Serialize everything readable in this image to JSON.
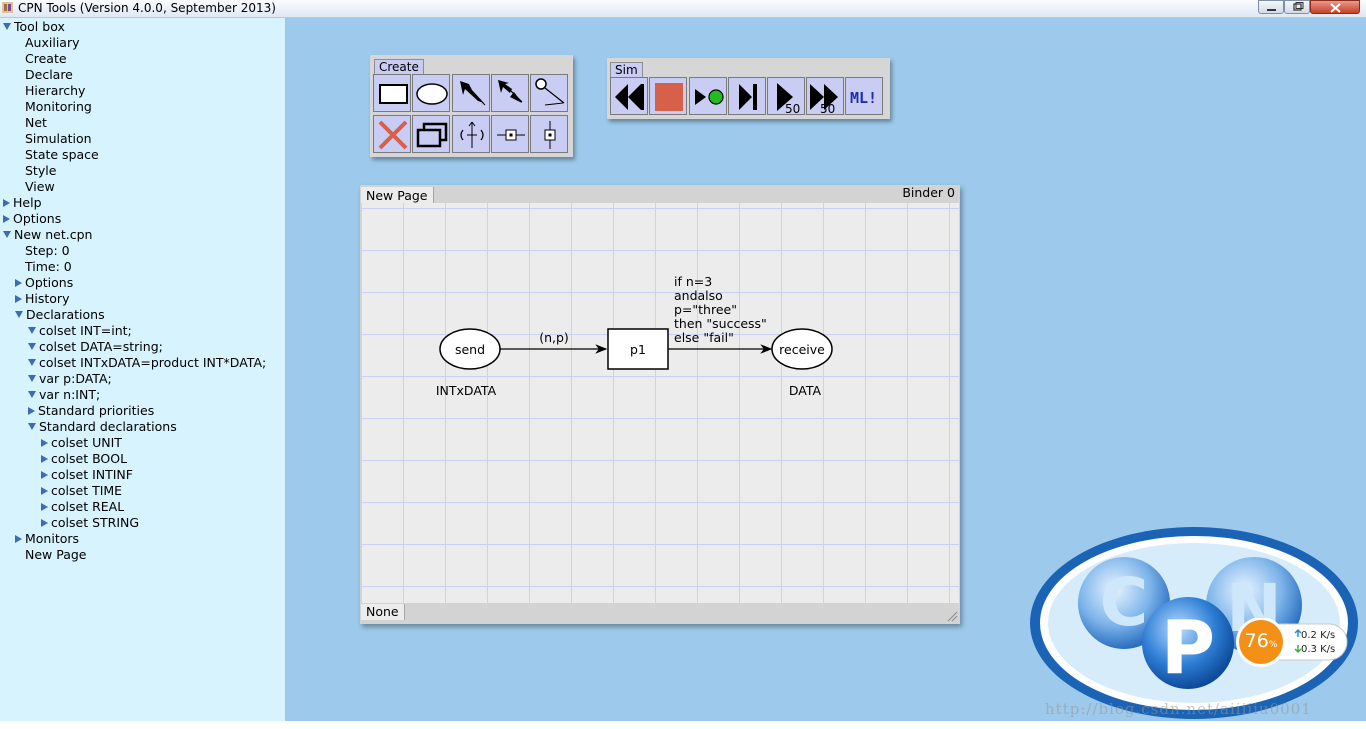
{
  "window": {
    "title": "CPN Tools (Version 4.0.0, September 2013)"
  },
  "sidebar": {
    "items": [
      {
        "label": "Tool box",
        "indent": 0,
        "expander": "down"
      },
      {
        "label": "Auxiliary",
        "indent": 1,
        "expander": "none"
      },
      {
        "label": "Create",
        "indent": 1,
        "expander": "none"
      },
      {
        "label": "Declare",
        "indent": 1,
        "expander": "none"
      },
      {
        "label": "Hierarchy",
        "indent": 1,
        "expander": "none"
      },
      {
        "label": "Monitoring",
        "indent": 1,
        "expander": "none"
      },
      {
        "label": "Net",
        "indent": 1,
        "expander": "none"
      },
      {
        "label": "Simulation",
        "indent": 1,
        "expander": "none"
      },
      {
        "label": "State space",
        "indent": 1,
        "expander": "none"
      },
      {
        "label": "Style",
        "indent": 1,
        "expander": "none"
      },
      {
        "label": "View",
        "indent": 1,
        "expander": "none"
      },
      {
        "label": "Help",
        "indent": 0,
        "expander": "right"
      },
      {
        "label": "Options",
        "indent": 0,
        "expander": "right"
      },
      {
        "label": "New net.cpn",
        "indent": 0,
        "expander": "down"
      },
      {
        "label": "Step: 0",
        "indent": 1,
        "expander": "none"
      },
      {
        "label": "Time: 0",
        "indent": 1,
        "expander": "none"
      },
      {
        "label": "Options",
        "indent": 1,
        "expander": "right"
      },
      {
        "label": "History",
        "indent": 1,
        "expander": "right"
      },
      {
        "label": "Declarations",
        "indent": 1,
        "expander": "down"
      },
      {
        "label": "colset INT=int;",
        "indent": 2,
        "expander": "down"
      },
      {
        "label": "colset DATA=string;",
        "indent": 2,
        "expander": "down"
      },
      {
        "label": "colset INTxDATA=product INT*DATA;",
        "indent": 2,
        "expander": "down"
      },
      {
        "label": "var p:DATA;",
        "indent": 2,
        "expander": "down"
      },
      {
        "label": "var n:INT;",
        "indent": 2,
        "expander": "down"
      },
      {
        "label": "Standard priorities",
        "indent": 2,
        "expander": "right"
      },
      {
        "label": "Standard declarations",
        "indent": 2,
        "expander": "down"
      },
      {
        "label": "colset UNIT",
        "indent": 3,
        "expander": "right"
      },
      {
        "label": "colset BOOL",
        "indent": 3,
        "expander": "right"
      },
      {
        "label": "colset INTINF",
        "indent": 3,
        "expander": "right"
      },
      {
        "label": "colset TIME",
        "indent": 3,
        "expander": "right"
      },
      {
        "label": "colset REAL",
        "indent": 3,
        "expander": "right"
      },
      {
        "label": "colset STRING",
        "indent": 3,
        "expander": "right"
      },
      {
        "label": "Monitors",
        "indent": 1,
        "expander": "right"
      },
      {
        "label": "New Page",
        "indent": 1,
        "expander": "none"
      }
    ]
  },
  "create_palette": {
    "label": "Create",
    "tools": [
      "rectangle-tool-icon",
      "ellipse-tool-icon",
      "arc-tool-icon",
      "double-arc-tool-icon",
      "inhibitor-arc-tool-icon",
      "delete-tool-icon",
      "clone-tool-icon",
      "toggle-direction-icon",
      "horizontal-guideline-icon",
      "vertical-guideline-icon"
    ]
  },
  "sim_palette": {
    "label": "Sim",
    "tools": [
      {
        "icon": "rewind-icon",
        "text": ""
      },
      {
        "icon": "stop-icon",
        "text": ""
      },
      {
        "icon": "single-step-icon",
        "text": ""
      },
      {
        "icon": "step-end-icon",
        "text": ""
      },
      {
        "icon": "play-steps-icon",
        "text": "50"
      },
      {
        "icon": "fast-forward-icon",
        "text": "50"
      },
      {
        "icon": "ml-evaluate-icon",
        "text": "ML!"
      }
    ]
  },
  "binder": {
    "tab_label": "New Page",
    "binder_label": "Binder 0",
    "bottom_tab": "None"
  },
  "net": {
    "place_send": {
      "name": "send",
      "colset": "INTxDATA"
    },
    "arc_in_label": "(n,p)",
    "transition": {
      "name": "p1"
    },
    "arc_out_guard": "if n=3\nandalso\np=\"three\"\nthen \"success\"\nelse \"fail\"",
    "place_receive": {
      "name": "receive",
      "colset": "DATA"
    }
  },
  "network_monitor": {
    "percent": "76",
    "percent_sign": "%",
    "upload": "0.2 K/s",
    "download": "0.3 K/s"
  },
  "watermark": "http://blog.csdn.net/aiiiiiu0001",
  "colors": {
    "sidebar_bg": "#d6f3fe",
    "workspace_bg": "#9dcaec",
    "palette_cell": "#c9cdf4",
    "canvas_bg": "#ececec",
    "grid": "#cdd0f3",
    "logo_blue": "#1a63b5",
    "monitor_orange": "#f39015"
  }
}
